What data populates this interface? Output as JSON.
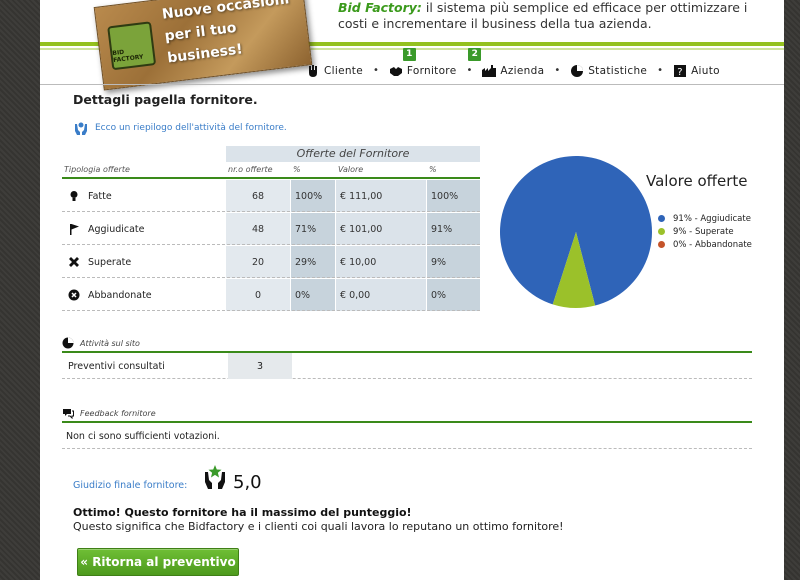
{
  "header": {
    "brand": "Bid Factory:",
    "tagline": " il sistema più semplice ed efficace per ottimizzare i costi e incrementare il business della tua azienda.",
    "logo_line1": "Nuove occasioni",
    "logo_line2": "per il tuo business!",
    "logo_badge": "BID FACTORY"
  },
  "nav": {
    "items": [
      {
        "label": "Cliente",
        "icon": "hand-icon",
        "badge": ""
      },
      {
        "label": "Fornitore",
        "icon": "handshake-icon",
        "badge": "1"
      },
      {
        "label": "Azienda",
        "icon": "factory-icon",
        "badge": "2"
      },
      {
        "label": "Statistiche",
        "icon": "pie-icon",
        "badge": ""
      },
      {
        "label": "Aiuto",
        "icon": "help-icon",
        "badge": ""
      }
    ]
  },
  "page": {
    "title": "Dettagli pagella fornitore.",
    "intro": "Ecco un riepilogo dell'attività del fornitore."
  },
  "offers": {
    "group_header": "Offerte del Fornitore",
    "col_type": "Tipologia offerte",
    "col_count": "nr.o offerte",
    "col_pct": "%",
    "col_value": "Valore",
    "col_value_pct": "%",
    "rows": [
      {
        "label": "Fatte",
        "icon": "bulb-icon",
        "count": "68",
        "pct": "100%",
        "value": "€ 111,00",
        "value_pct": "100%"
      },
      {
        "label": "Aggiudicate",
        "icon": "flag-icon",
        "count": "48",
        "pct": "71%",
        "value": "€ 101,00",
        "value_pct": "91%"
      },
      {
        "label": "Superate",
        "icon": "crossed-icon",
        "count": "20",
        "pct": "29%",
        "value": "€ 10,00",
        "value_pct": "9%"
      },
      {
        "label": "Abbandonate",
        "icon": "cancel-circle-icon",
        "count": "0",
        "pct": "0%",
        "value": "€ 0,00",
        "value_pct": "0%"
      }
    ]
  },
  "chart_data": {
    "type": "pie",
    "title": "Valore offerte",
    "categories": [
      "91% - Aggiudicate",
      "9% - Superate",
      "0% - Abbandonate"
    ],
    "values": [
      91,
      9,
      0
    ],
    "colors": [
      "#2f64b8",
      "#9bc12a",
      "#c5542a"
    ],
    "legend": "right"
  },
  "activity": {
    "header": "Attività sul sito",
    "label": "Preventivi consultati",
    "value": "3"
  },
  "feedback": {
    "header": "Feedback fornitore",
    "text": "Non ci sono sufficienti votazioni."
  },
  "judgement": {
    "label": "Giudizio finale fornitore:",
    "value": "5,0",
    "verdict_title": "Ottimo! Questo fornitore ha il massimo del punteggio!",
    "verdict_text": "Questo significa che Bidfactory e i clienti coi quali lavora lo reputano un ottimo fornitore!"
  },
  "actions": {
    "back_label": "« Ritorna al preventivo"
  },
  "colors": {
    "accent_green": "#3a8a1a",
    "link_blue": "#3a7dc8",
    "button_green": "#5aa826"
  }
}
